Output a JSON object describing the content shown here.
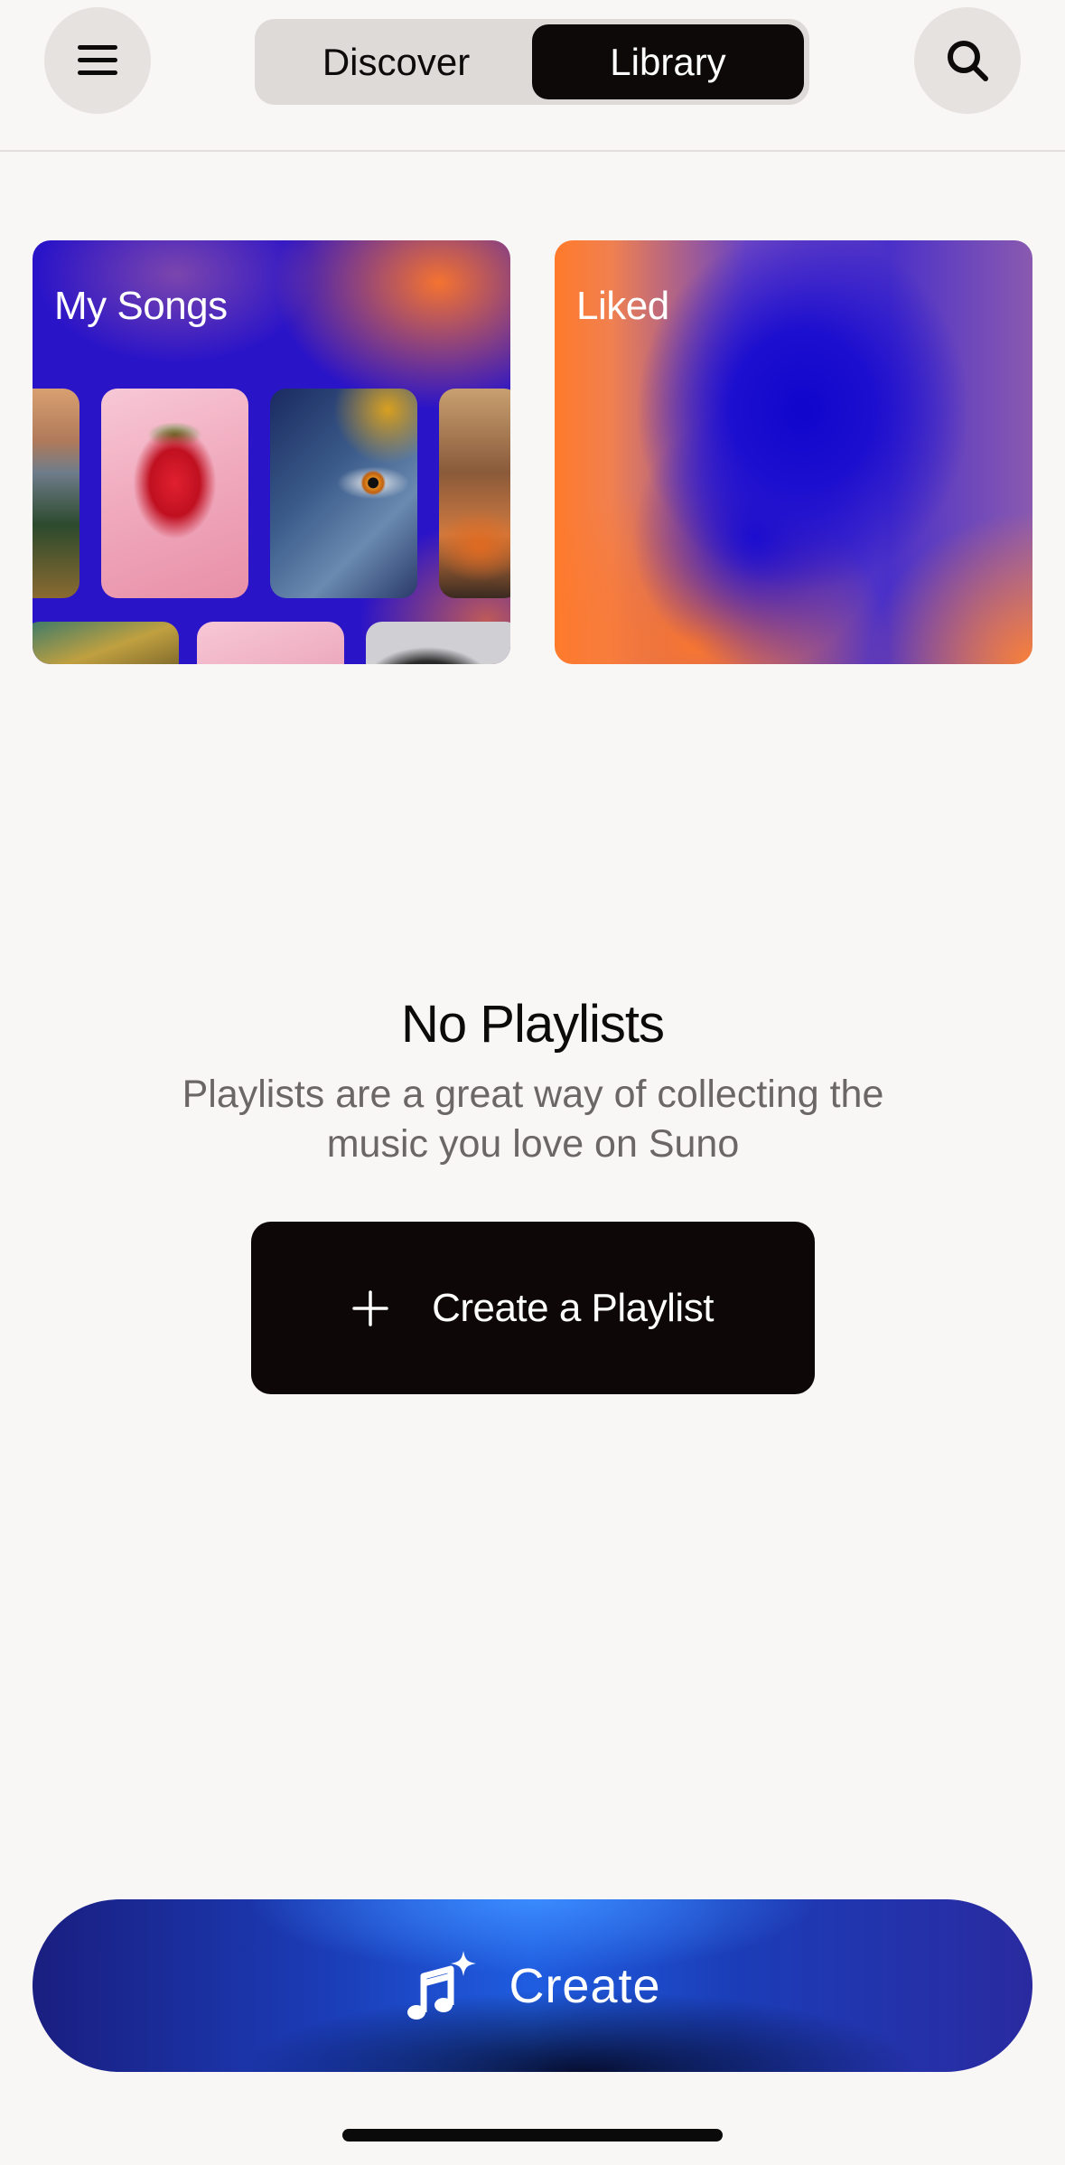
{
  "header": {
    "menu_icon": "hamburger-menu-icon",
    "search_icon": "search-icon",
    "tabs": [
      {
        "label": "Discover",
        "active": false
      },
      {
        "label": "Library",
        "active": true
      }
    ]
  },
  "library": {
    "cards": [
      {
        "title": "My Songs"
      },
      {
        "title": "Liked"
      }
    ]
  },
  "empty_state": {
    "title": "No Playlists",
    "description": "Playlists are a great way of collecting the music you love on Suno",
    "button_label": "Create a Playlist",
    "button_icon": "plus-icon"
  },
  "bottom": {
    "create_label": "Create",
    "create_icon": "music-sparkle-icon"
  },
  "colors": {
    "background": "#f9f7f6",
    "active_tab": "#0d0909",
    "card_blue": "#2a14c8",
    "card_orange": "#ff7a2a",
    "create_blue": "#1f5de0"
  }
}
